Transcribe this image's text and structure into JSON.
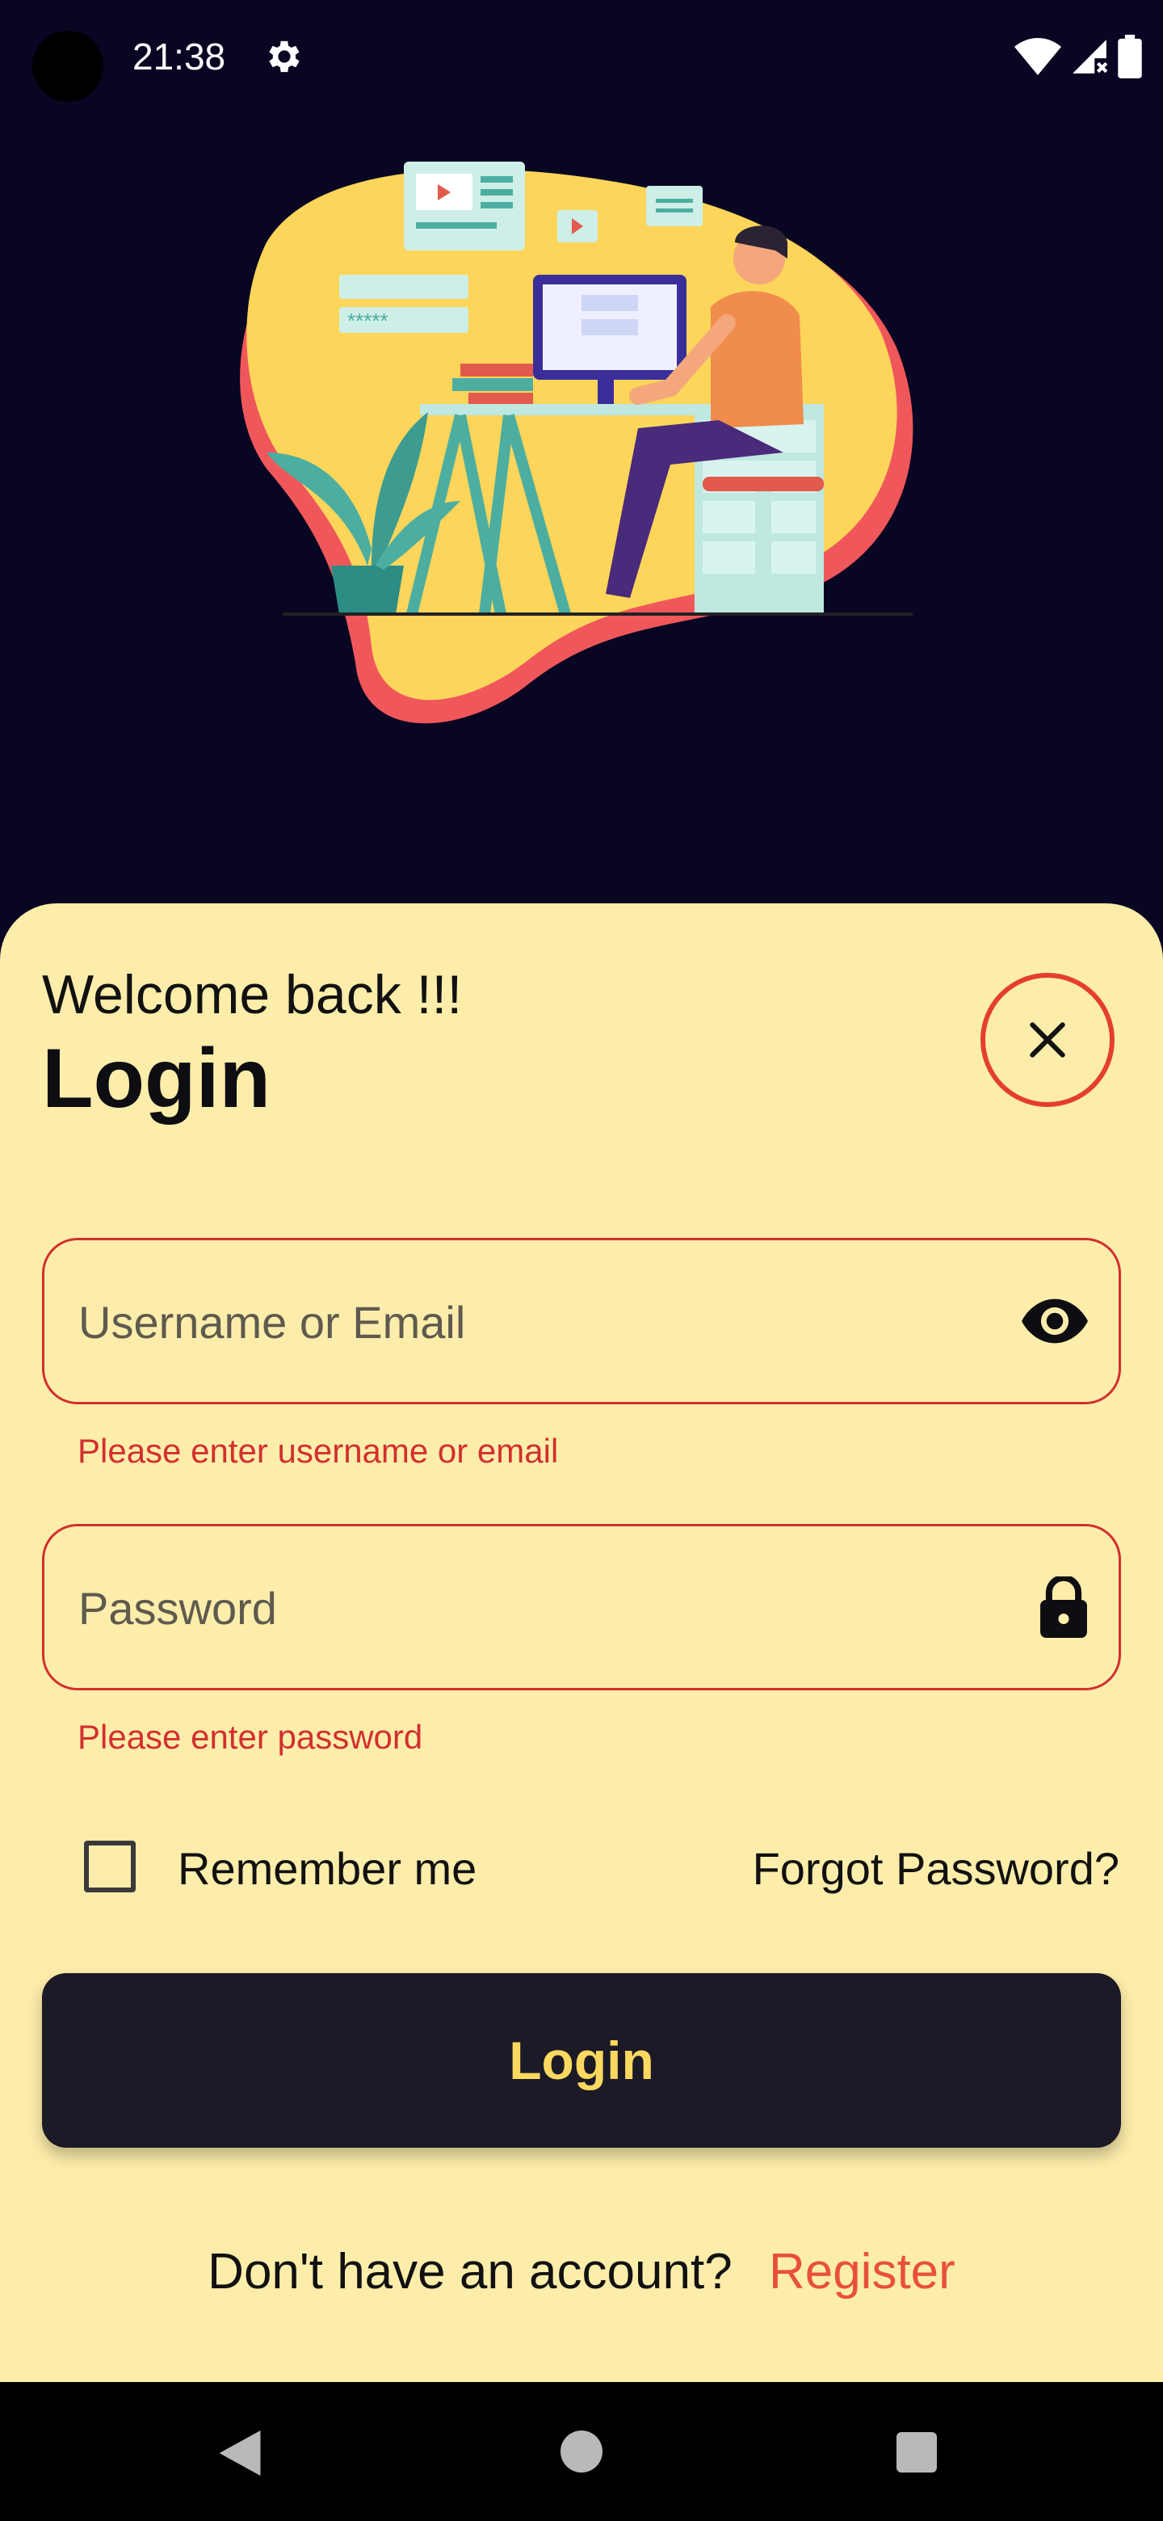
{
  "status_bar": {
    "time": "21:38"
  },
  "colors": {
    "background": "#080622",
    "sheet": "#fdedab",
    "accent_red": "#e53e2f",
    "error": "#d32f2f",
    "button": "#1c1a26",
    "button_text": "#fbd960"
  },
  "login": {
    "welcome": "Welcome back !!!",
    "title": "Login",
    "username": {
      "placeholder": "Username or Email",
      "value": "",
      "error": "Please enter username or email",
      "trailing_icon": "eye-icon"
    },
    "password": {
      "placeholder": "Password",
      "value": "",
      "error": "Please enter password",
      "trailing_icon": "lock-icon"
    },
    "remember_label": "Remember me",
    "remember_checked": false,
    "forgot_label": "Forgot Password?",
    "submit_label": "Login",
    "register_prompt": "Don't have an account?",
    "register_link": "Register"
  }
}
